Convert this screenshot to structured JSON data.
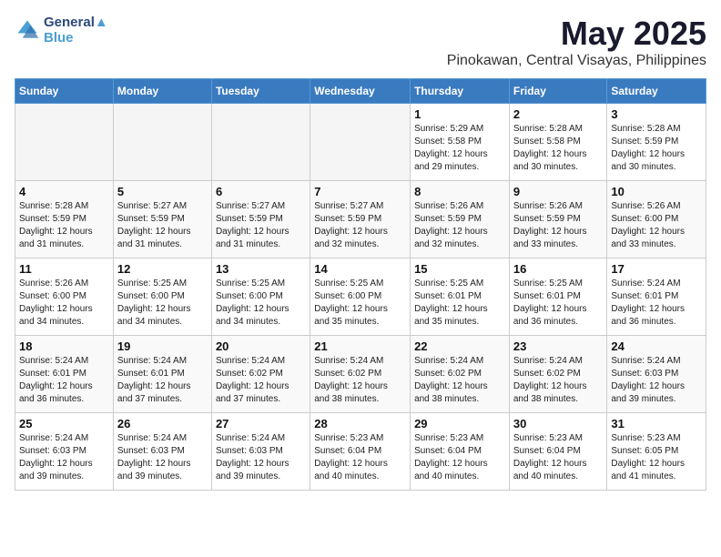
{
  "logo": {
    "line1": "General",
    "line2": "Blue"
  },
  "title": "May 2025",
  "subtitle": "Pinokawan, Central Visayas, Philippines",
  "weekdays": [
    "Sunday",
    "Monday",
    "Tuesday",
    "Wednesday",
    "Thursday",
    "Friday",
    "Saturday"
  ],
  "weeks": [
    [
      {
        "day": "",
        "info": ""
      },
      {
        "day": "",
        "info": ""
      },
      {
        "day": "",
        "info": ""
      },
      {
        "day": "",
        "info": ""
      },
      {
        "day": "1",
        "info": "Sunrise: 5:29 AM\nSunset: 5:58 PM\nDaylight: 12 hours\nand 29 minutes."
      },
      {
        "day": "2",
        "info": "Sunrise: 5:28 AM\nSunset: 5:58 PM\nDaylight: 12 hours\nand 30 minutes."
      },
      {
        "day": "3",
        "info": "Sunrise: 5:28 AM\nSunset: 5:59 PM\nDaylight: 12 hours\nand 30 minutes."
      }
    ],
    [
      {
        "day": "4",
        "info": "Sunrise: 5:28 AM\nSunset: 5:59 PM\nDaylight: 12 hours\nand 31 minutes."
      },
      {
        "day": "5",
        "info": "Sunrise: 5:27 AM\nSunset: 5:59 PM\nDaylight: 12 hours\nand 31 minutes."
      },
      {
        "day": "6",
        "info": "Sunrise: 5:27 AM\nSunset: 5:59 PM\nDaylight: 12 hours\nand 31 minutes."
      },
      {
        "day": "7",
        "info": "Sunrise: 5:27 AM\nSunset: 5:59 PM\nDaylight: 12 hours\nand 32 minutes."
      },
      {
        "day": "8",
        "info": "Sunrise: 5:26 AM\nSunset: 5:59 PM\nDaylight: 12 hours\nand 32 minutes."
      },
      {
        "day": "9",
        "info": "Sunrise: 5:26 AM\nSunset: 5:59 PM\nDaylight: 12 hours\nand 33 minutes."
      },
      {
        "day": "10",
        "info": "Sunrise: 5:26 AM\nSunset: 6:00 PM\nDaylight: 12 hours\nand 33 minutes."
      }
    ],
    [
      {
        "day": "11",
        "info": "Sunrise: 5:26 AM\nSunset: 6:00 PM\nDaylight: 12 hours\nand 34 minutes."
      },
      {
        "day": "12",
        "info": "Sunrise: 5:25 AM\nSunset: 6:00 PM\nDaylight: 12 hours\nand 34 minutes."
      },
      {
        "day": "13",
        "info": "Sunrise: 5:25 AM\nSunset: 6:00 PM\nDaylight: 12 hours\nand 34 minutes."
      },
      {
        "day": "14",
        "info": "Sunrise: 5:25 AM\nSunset: 6:00 PM\nDaylight: 12 hours\nand 35 minutes."
      },
      {
        "day": "15",
        "info": "Sunrise: 5:25 AM\nSunset: 6:01 PM\nDaylight: 12 hours\nand 35 minutes."
      },
      {
        "day": "16",
        "info": "Sunrise: 5:25 AM\nSunset: 6:01 PM\nDaylight: 12 hours\nand 36 minutes."
      },
      {
        "day": "17",
        "info": "Sunrise: 5:24 AM\nSunset: 6:01 PM\nDaylight: 12 hours\nand 36 minutes."
      }
    ],
    [
      {
        "day": "18",
        "info": "Sunrise: 5:24 AM\nSunset: 6:01 PM\nDaylight: 12 hours\nand 36 minutes."
      },
      {
        "day": "19",
        "info": "Sunrise: 5:24 AM\nSunset: 6:01 PM\nDaylight: 12 hours\nand 37 minutes."
      },
      {
        "day": "20",
        "info": "Sunrise: 5:24 AM\nSunset: 6:02 PM\nDaylight: 12 hours\nand 37 minutes."
      },
      {
        "day": "21",
        "info": "Sunrise: 5:24 AM\nSunset: 6:02 PM\nDaylight: 12 hours\nand 38 minutes."
      },
      {
        "day": "22",
        "info": "Sunrise: 5:24 AM\nSunset: 6:02 PM\nDaylight: 12 hours\nand 38 minutes."
      },
      {
        "day": "23",
        "info": "Sunrise: 5:24 AM\nSunset: 6:02 PM\nDaylight: 12 hours\nand 38 minutes."
      },
      {
        "day": "24",
        "info": "Sunrise: 5:24 AM\nSunset: 6:03 PM\nDaylight: 12 hours\nand 39 minutes."
      }
    ],
    [
      {
        "day": "25",
        "info": "Sunrise: 5:24 AM\nSunset: 6:03 PM\nDaylight: 12 hours\nand 39 minutes."
      },
      {
        "day": "26",
        "info": "Sunrise: 5:24 AM\nSunset: 6:03 PM\nDaylight: 12 hours\nand 39 minutes."
      },
      {
        "day": "27",
        "info": "Sunrise: 5:24 AM\nSunset: 6:03 PM\nDaylight: 12 hours\nand 39 minutes."
      },
      {
        "day": "28",
        "info": "Sunrise: 5:23 AM\nSunset: 6:04 PM\nDaylight: 12 hours\nand 40 minutes."
      },
      {
        "day": "29",
        "info": "Sunrise: 5:23 AM\nSunset: 6:04 PM\nDaylight: 12 hours\nand 40 minutes."
      },
      {
        "day": "30",
        "info": "Sunrise: 5:23 AM\nSunset: 6:04 PM\nDaylight: 12 hours\nand 40 minutes."
      },
      {
        "day": "31",
        "info": "Sunrise: 5:23 AM\nSunset: 6:05 PM\nDaylight: 12 hours\nand 41 minutes."
      }
    ]
  ]
}
